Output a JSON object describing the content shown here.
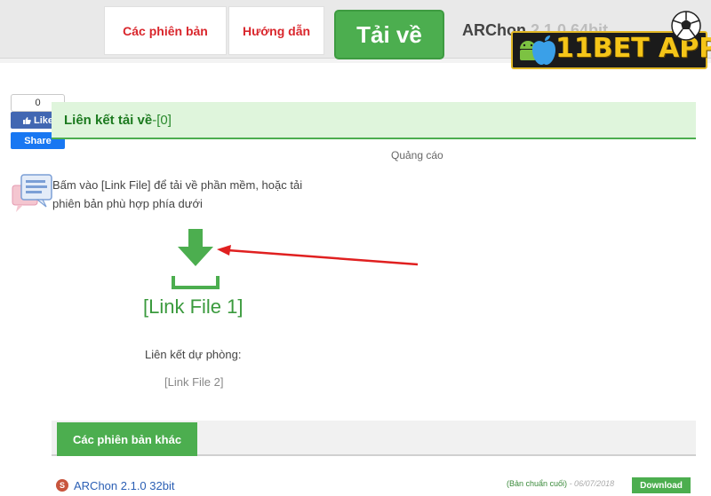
{
  "header": {
    "tabs": [
      {
        "label": "Các phiên bản"
      },
      {
        "label": "Hướng dẫn"
      }
    ],
    "download_label": "Tải về",
    "app_title": "ARChon",
    "app_title_version": " 2.1.0 64bit"
  },
  "brand": {
    "text": "11BET APP",
    "color": "#f5c518"
  },
  "social": {
    "count": "0",
    "like_label": "Like",
    "share_label": "Share"
  },
  "links": {
    "heading": "Liên kết tải về",
    "separator": " - ",
    "count": "[0]",
    "ad_label": "Quảng cáo",
    "instruction": "Bấm vào [Link File] để tải về phần mềm, hoặc tải phiên bản phù hợp phía dưới",
    "link_file_1": "[Link File 1]",
    "backup_label": "Liên kết dự phòng:",
    "link_file_2": "[Link File 2]"
  },
  "other_versions": {
    "tab_label": "Các phiên bản khác",
    "items": [
      {
        "icon_letter": "S",
        "name": "ARChon 2.1.0 32bit",
        "meta": "(Bản chuẩn cuối)",
        "date": "- 06/07/2018",
        "download_label": "Download"
      }
    ]
  },
  "colors": {
    "accent_green": "#4cae4f",
    "accent_red": "#d9262c",
    "arrow_red": "#e02020"
  }
}
